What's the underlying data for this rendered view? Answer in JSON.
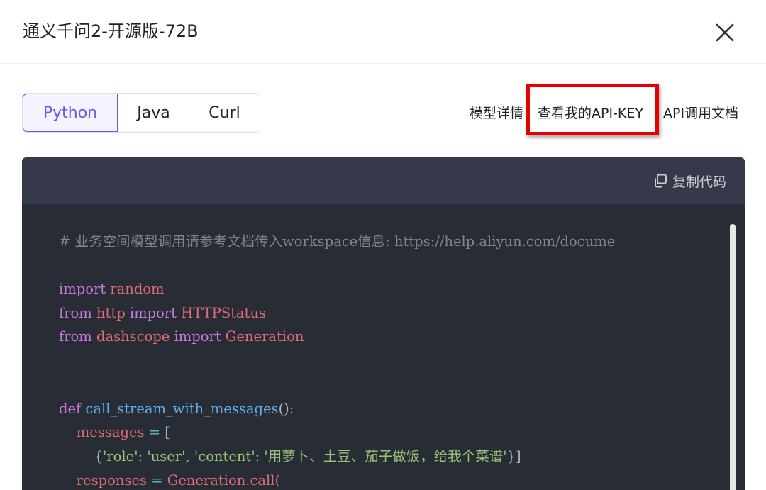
{
  "modal": {
    "title": "通义千问2-开源版-72B"
  },
  "tabs": [
    {
      "label": "Python",
      "active": true
    },
    {
      "label": "Java",
      "active": false
    },
    {
      "label": "Curl",
      "active": false
    }
  ],
  "links": {
    "model_detail": "模型详情",
    "view_api_key": "查看我的API-KEY",
    "api_docs": "API调用文档"
  },
  "code_panel": {
    "copy_label": "复制代码",
    "lines": {
      "l1_comment": "# 业务空间模型调用请参考文档传入workspace信息: https://help.aliyun.com/docume",
      "l3_import": "import",
      "l3_mod": " random",
      "l4_from": "from",
      "l4_mod": " http ",
      "l4_import": "import",
      "l4_name": " HTTPStatus",
      "l5_from": "from",
      "l5_mod": " dashscope ",
      "l5_import": "import",
      "l5_name": " Generation",
      "l8_def": "def",
      "l8_fn": " call_stream_with_messages",
      "l8_rest": "():",
      "l9_var": "    messages",
      "l9_op": " = ",
      "l9_bracket": "[",
      "l10_open": "        {",
      "l10_k1": "'role'",
      "l10_c1": ": ",
      "l10_v1": "'user'",
      "l10_c2": ", ",
      "l10_k2": "'content'",
      "l10_c3": ": ",
      "l10_v2": "'用萝卜、土豆、茄子做饭，给我个菜谱'",
      "l10_close": "}]",
      "l11_var": "    responses",
      "l11_op": " = ",
      "l11_call": "Generation.call("
    }
  },
  "colors": {
    "accent": "#615ced",
    "highlight": "#e60000",
    "code_bg": "#282c34",
    "code_toolbar_bg": "#353949"
  },
  "icons": {
    "close": "close-icon",
    "copy": "copy-icon"
  }
}
